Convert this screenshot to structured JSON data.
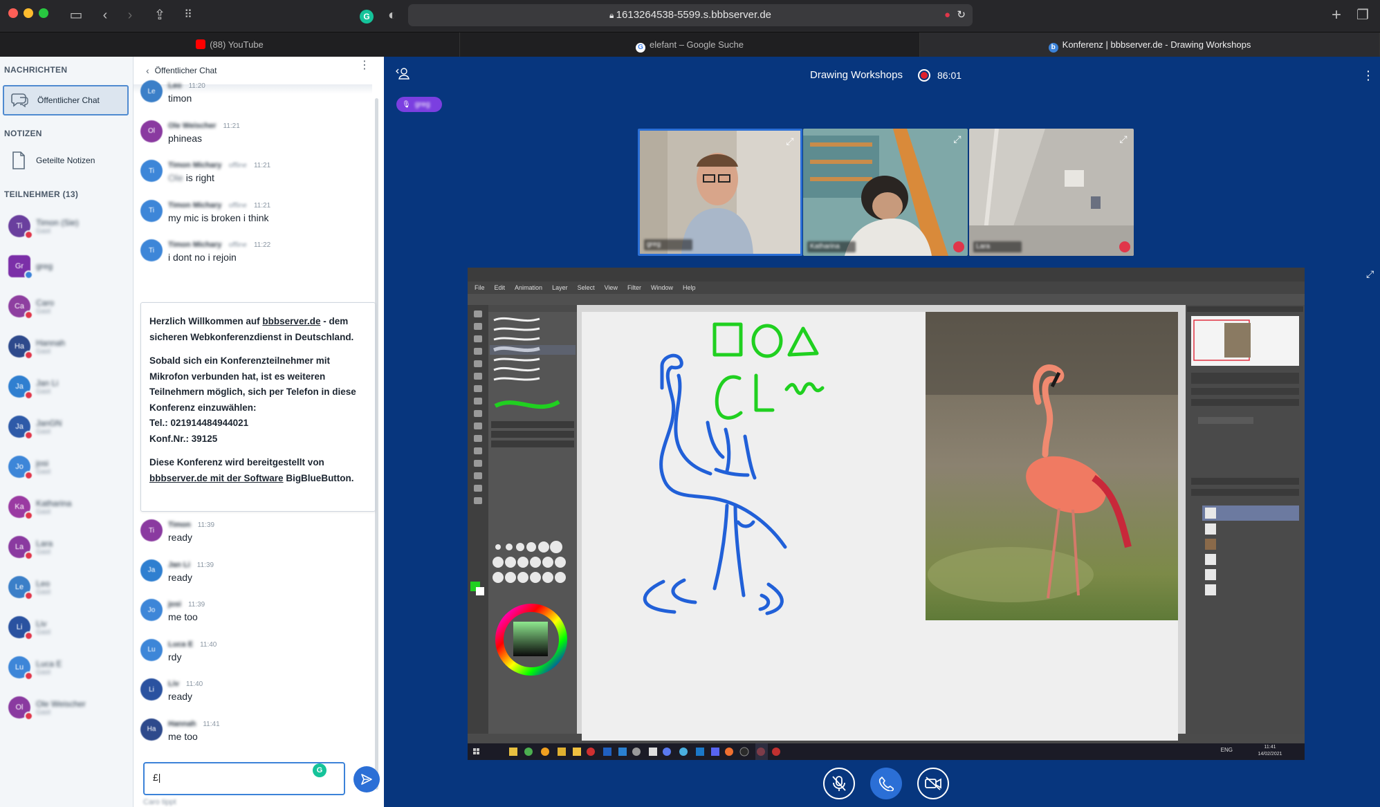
{
  "browser": {
    "url": "1613264538-5599.s.bbbserver.de",
    "tabs": [
      {
        "label": "(88) YouTube",
        "active": false,
        "favicon_color": "#ff0000"
      },
      {
        "label": "elefant – Google Suche",
        "active": false,
        "favicon_color": "#4285f4"
      },
      {
        "label": "Konferenz | bbbserver.de - Drawing Workshops",
        "active": true,
        "favicon_color": "#3b82d8"
      }
    ]
  },
  "sidebar": {
    "messages_header": "NACHRICHTEN",
    "public_chat_label": "Öffentlicher Chat",
    "notes_header": "NOTIZEN",
    "shared_notes_label": "Geteilte Notizen",
    "participants_header": "TEILNEHMER (13)",
    "participants": [
      {
        "initials": "Ti",
        "name": "Timon (Sie)",
        "role": "Gast",
        "color": "#6a3f9e",
        "status": "red"
      },
      {
        "initials": "Gr",
        "name": "greg",
        "role": "",
        "color": "#7b2fa8",
        "status": "blue",
        "square": true
      },
      {
        "initials": "Ca",
        "name": "Caro",
        "role": "Gast",
        "color": "#8e3fa0",
        "status": "red"
      },
      {
        "initials": "Ha",
        "name": "Hannah",
        "role": "Gast",
        "color": "#2e4a8c",
        "status": "red"
      },
      {
        "initials": "Ja",
        "name": "Jan Li",
        "role": "Gast",
        "color": "#2f7fd0",
        "status": "red"
      },
      {
        "initials": "Ja",
        "name": "JanGN",
        "role": "Gast",
        "color": "#2e5aa8",
        "status": "red"
      },
      {
        "initials": "Jo",
        "name": "josi",
        "role": "Gast",
        "color": "#3d86d8",
        "status": "red"
      },
      {
        "initials": "Ka",
        "name": "Katharina",
        "role": "Gast",
        "color": "#9a3aa2",
        "status": "red"
      },
      {
        "initials": "La",
        "name": "Lara",
        "role": "Gast",
        "color": "#8a3aa0",
        "status": "red"
      },
      {
        "initials": "Le",
        "name": "Leo",
        "role": "Gast",
        "color": "#3b7fc8",
        "status": "red"
      },
      {
        "initials": "Li",
        "name": "Liv",
        "role": "Gast",
        "color": "#2a52a0",
        "status": "red"
      },
      {
        "initials": "Lu",
        "name": "Luca E",
        "role": "Gast",
        "color": "#3d86d8",
        "status": "red"
      },
      {
        "initials": "Ol",
        "name": "Ole Weischer",
        "role": "Gast",
        "color": "#8a3aa0",
        "status": "red"
      }
    ]
  },
  "chat": {
    "title": "Öffentlicher Chat",
    "messages_top": [
      {
        "initials": "Le",
        "name": "Leo",
        "time": "11:20",
        "text": "timon",
        "color": "#3b7fc8"
      },
      {
        "initials": "Ol",
        "name": "Ole Weischer",
        "time": "11:21",
        "text": "phineas",
        "color": "#8a3aa0"
      },
      {
        "initials": "Ti",
        "name": "Timon Michary",
        "offline": "offline",
        "time": "11:21",
        "text_blur": "Ole",
        "text": "is right",
        "color": "#3d86d8"
      },
      {
        "initials": "Ti",
        "name": "Timon Michary",
        "offline": "offline",
        "time": "11:21",
        "text": "my mic is broken i think",
        "color": "#3d86d8"
      },
      {
        "initials": "Ti",
        "name": "Timon Michary",
        "offline": "offline",
        "time": "11:22",
        "text": "i dont no i rejoin",
        "color": "#3d86d8"
      }
    ],
    "welcome": {
      "line1_pre": "Herzlich Willkommen auf ",
      "line1_link": "bbbserver.de",
      "line1_post": " - dem sicheren Webkonferenzdienst in Deutschland.",
      "para2": "Sobald sich ein Konferenzteilnehmer mit Mikrofon verbunden hat, ist es weiteren Teilnehmern möglich, sich per Telefon in diese Konferenz einzuwählen:",
      "tel": "Tel.: 021914484944021",
      "conf": "Konf.Nr.: 39125",
      "para3_pre": "Diese Konferenz wird bereitgestellt von ",
      "para3_link": "bbbserver.de mit der Software",
      "para3_post": " BigBlueButton."
    },
    "messages_bottom": [
      {
        "initials": "Ti",
        "name": "Timon",
        "time": "11:39",
        "text": "ready",
        "color": "#8a3aa0"
      },
      {
        "initials": "Ja",
        "name": "Jan Li",
        "time": "11:39",
        "text": "ready",
        "color": "#2f7fd0"
      },
      {
        "initials": "Jo",
        "name": "josi",
        "time": "11:39",
        "text": "me too",
        "color": "#3d86d8"
      },
      {
        "initials": "Lu",
        "name": "Luca E",
        "time": "11:40",
        "text": "rdy",
        "color": "#3d86d8"
      },
      {
        "initials": "Li",
        "name": "Liv",
        "time": "11:40",
        "text": "ready",
        "color": "#2a52a0"
      },
      {
        "initials": "Ha",
        "name": "Hannah",
        "time": "11:41",
        "text": "me too",
        "color": "#2e4a8c"
      }
    ],
    "input_value": "£|",
    "typing": "Caro tippt"
  },
  "conference": {
    "title": "Drawing Workshops",
    "recording_time": "86:01",
    "talking_user": "greg",
    "videos": [
      {
        "name": "greg",
        "bg": "#c9c2b6",
        "muted": false,
        "active": true
      },
      {
        "name": "Katharina",
        "bg": "#7aa2a4",
        "muted": true,
        "active": false
      },
      {
        "name": "Lara",
        "bg": "#b8b5b0",
        "muted": true,
        "active": false
      }
    ],
    "screenshare": {
      "menu": [
        "File",
        "Edit",
        "Animation",
        "Layer",
        "Select",
        "View",
        "Filter",
        "Window",
        "Help"
      ],
      "taskbar_time": "11:41",
      "taskbar_date": "14/02/2021",
      "taskbar_lang": "ENG"
    }
  },
  "colors": {
    "main_bg": "#07367e",
    "accent": "#2b6fd6",
    "drawing_blue": "#2160d8",
    "drawing_green": "#20d020"
  }
}
